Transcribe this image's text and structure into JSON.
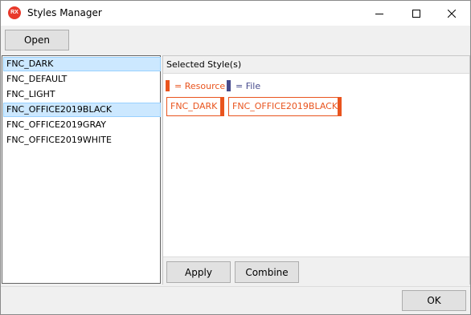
{
  "window": {
    "title": "Styles Manager",
    "icon_label": "RX",
    "brand_color": "#e8392b"
  },
  "toolbar": {
    "open_label": "Open"
  },
  "styles_list": {
    "items": [
      {
        "label": "FNC_DARK",
        "selected": true
      },
      {
        "label": "FNC_DEFAULT",
        "selected": false
      },
      {
        "label": "FNC_LIGHT",
        "selected": false
      },
      {
        "label": "FNC_OFFICE2019BLACK",
        "selected": true
      },
      {
        "label": "FNC_OFFICE2019GRAY",
        "selected": false
      },
      {
        "label": "FNC_OFFICE2019WHITE",
        "selected": false
      }
    ]
  },
  "selected_panel": {
    "header": "Selected Style(s)",
    "legend": {
      "resource_label": "= Resource",
      "resource_color": "#e9541e",
      "file_label": "= File",
      "file_color": "#464a8c"
    },
    "chips": [
      "FNC_DARK",
      "FNC_OFFICE2019BLACK"
    ],
    "apply_label": "Apply",
    "combine_label": "Combine"
  },
  "footer": {
    "ok_label": "OK"
  }
}
